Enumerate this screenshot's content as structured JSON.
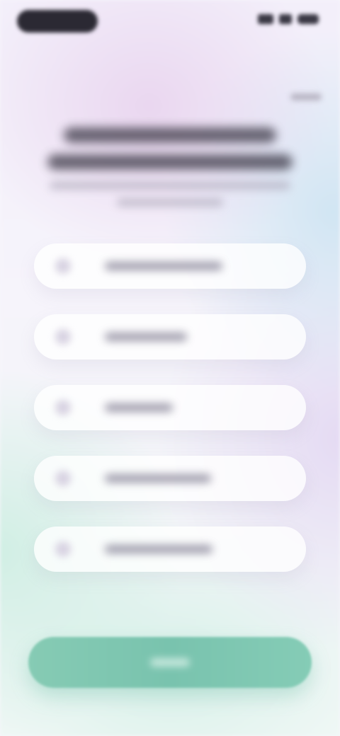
{
  "screen": {
    "accent_color": "#7fc8b2",
    "background_tint": "#f5f3fa"
  },
  "status_bar": {
    "icons": [
      "signal-icon",
      "wifi-icon",
      "battery-icon"
    ]
  },
  "options": {
    "count": 5
  }
}
